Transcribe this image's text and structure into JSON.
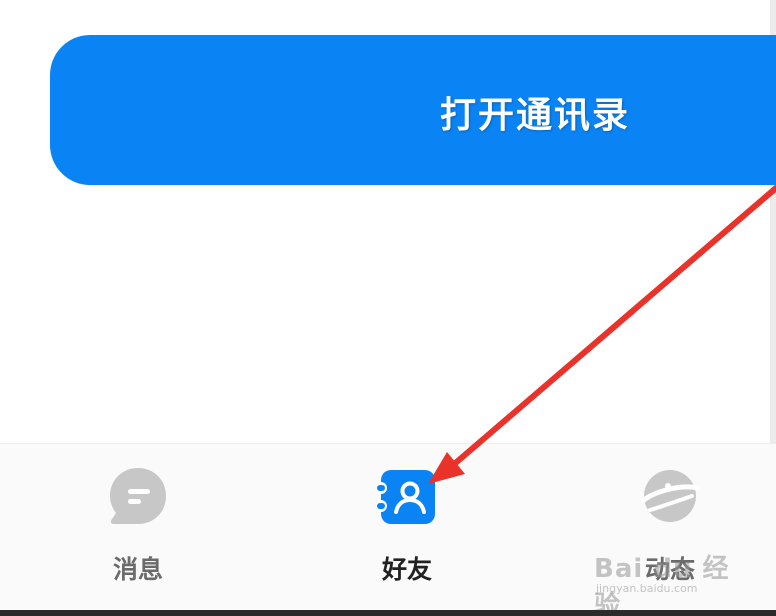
{
  "banner": {
    "label": "打开通讯录"
  },
  "tabbar": {
    "tabs": [
      {
        "label": "消息",
        "icon": "message-icon",
        "active": false
      },
      {
        "label": "好友",
        "icon": "contacts-icon",
        "active": true
      },
      {
        "label": "动态",
        "icon": "planet-icon",
        "active": false
      }
    ]
  },
  "colors": {
    "accent": "#0a84f4",
    "annotation_arrow": "#e8322a",
    "inactive_icon": "#c7c7c7"
  },
  "watermark": {
    "logo": "Bai du 经验",
    "site": "jingyan.baidu.com"
  }
}
